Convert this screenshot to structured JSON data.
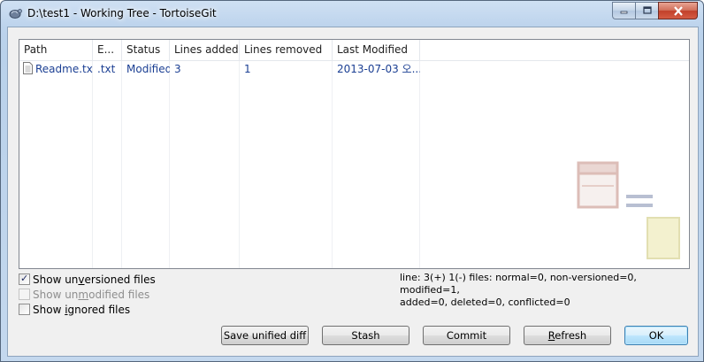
{
  "window": {
    "title": "D:\\test1 - Working Tree - TortoiseGit",
    "controls": {
      "minimize_icon": "minimize-icon",
      "maximize_icon": "maximize-icon",
      "close_icon": "close-icon"
    }
  },
  "list": {
    "columns": [
      "Path",
      "E...",
      "Status",
      "Lines added",
      "Lines removed",
      "Last Modified"
    ],
    "rows": [
      {
        "path": "Readme.txt",
        "ext": ".txt",
        "status": "Modified",
        "lines_added": "3",
        "lines_removed": "1",
        "last_modified": "2013-07-03 오..."
      }
    ],
    "row_text_color": "#1b3f93"
  },
  "options": {
    "show_unversioned": {
      "pre": "Show un",
      "u": "v",
      "post": "ersioned files",
      "checked": true,
      "enabled": true
    },
    "show_unmodified": {
      "pre": "Show un",
      "u": "m",
      "post": "odified files",
      "checked": false,
      "enabled": false
    },
    "show_ignored": {
      "pre": "Show ",
      "u": "i",
      "post": "gnored files",
      "checked": false,
      "enabled": true
    }
  },
  "status": {
    "line1": "line: 3(+) 1(-) files: normal=0, non-versioned=0, modified=1,",
    "line2": "added=0, deleted=0, conflicted=0"
  },
  "buttons": {
    "save_unified_diff": "Save unified diff",
    "stash": "Stash",
    "commit": "Commit",
    "refresh_pre": "",
    "refresh_u": "R",
    "refresh_post": "efresh",
    "ok": "OK"
  },
  "colors": {
    "accent": "#3c7fb1",
    "close_button": "#c2402a"
  }
}
